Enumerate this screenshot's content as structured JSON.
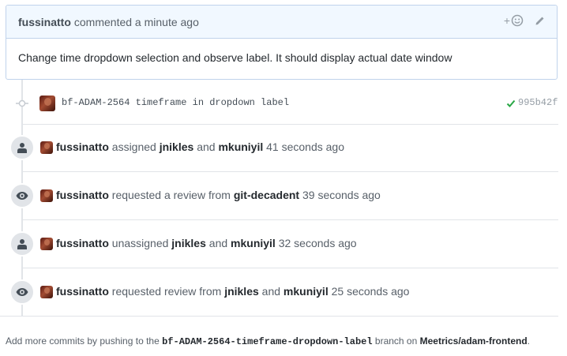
{
  "comment": {
    "author": "fussinatto",
    "meta": "commented a minute ago",
    "body": "Change time dropdown selection and observe label. It should display actual date window",
    "add_reaction_label": "+"
  },
  "commit": {
    "message": "bf-ADAM-2564 timeframe in dropdown label",
    "sha": "995b42f"
  },
  "events": [
    {
      "icon": "person-icon",
      "actor": "fussinatto",
      "action": "assigned",
      "user1": "jnikles",
      "conj": "and",
      "user2": "mkuniyil",
      "time": "41 seconds ago"
    },
    {
      "icon": "eye-icon",
      "actor": "fussinatto",
      "action": "requested a review from",
      "user1": "git-decadent",
      "time": "39 seconds ago"
    },
    {
      "icon": "person-icon",
      "actor": "fussinatto",
      "action": "unassigned",
      "user1": "jnikles",
      "conj": "and",
      "user2": "mkuniyil",
      "time": "32 seconds ago"
    },
    {
      "icon": "eye-icon",
      "actor": "fussinatto",
      "action": "requested review from",
      "user1": "jnikles",
      "conj": "and",
      "user2": "mkuniyil",
      "time": "25 seconds ago"
    }
  ],
  "footer": {
    "prefix": "Add more commits by pushing to the",
    "branch": "bf-ADAM-2564-timeframe-dropdown-label",
    "middle": "branch on",
    "repo": "Meetrics/adam-frontend",
    "suffix": "."
  }
}
